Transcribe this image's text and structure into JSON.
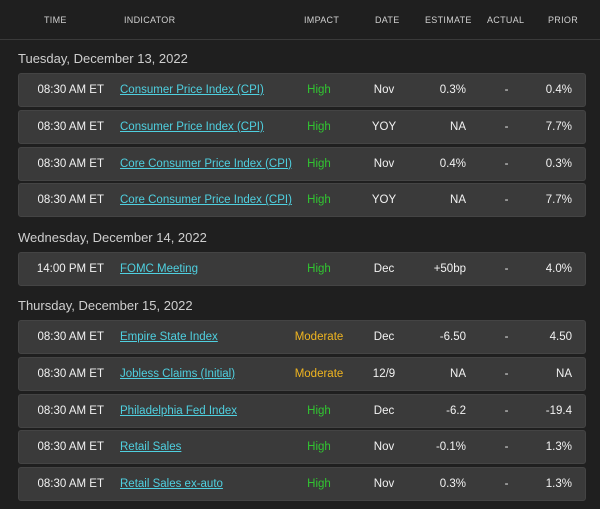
{
  "header": {
    "time": "TIME",
    "indicator": "INDICATOR",
    "impact": "IMPACT",
    "date": "DATE",
    "estimate": "ESTIMATE",
    "actual": "ACTUAL",
    "prior": "PRIOR"
  },
  "colors": {
    "link": "#4fd0e0",
    "high": "#31c531",
    "moderate": "#f0b520",
    "row_bg": "#3a3a3a",
    "page_bg": "#1f1f1f"
  },
  "days": [
    {
      "label": "Tuesday, December 13, 2022",
      "rows": [
        {
          "time": "08:30 AM ET",
          "indicator": "Consumer Price Index (CPI)",
          "impact": "High",
          "date": "Nov",
          "estimate": "0.3%",
          "actual": "-",
          "prior": "0.4%"
        },
        {
          "time": "08:30 AM ET",
          "indicator": "Consumer Price Index (CPI)",
          "impact": "High",
          "date": "YOY",
          "estimate": "NA",
          "actual": "-",
          "prior": "7.7%"
        },
        {
          "time": "08:30 AM ET",
          "indicator": "Core Consumer Price Index (CPI)",
          "impact": "High",
          "date": "Nov",
          "estimate": "0.4%",
          "actual": "-",
          "prior": "0.3%"
        },
        {
          "time": "08:30 AM ET",
          "indicator": "Core Consumer Price Index (CPI)",
          "impact": "High",
          "date": "YOY",
          "estimate": "NA",
          "actual": "-",
          "prior": "7.7%"
        }
      ]
    },
    {
      "label": "Wednesday, December 14, 2022",
      "rows": [
        {
          "time": "14:00 PM ET",
          "indicator": "FOMC Meeting",
          "impact": "High",
          "date": "Dec",
          "estimate": "+50bp",
          "actual": "-",
          "prior": "4.0%"
        }
      ]
    },
    {
      "label": "Thursday, December 15, 2022",
      "rows": [
        {
          "time": "08:30 AM ET",
          "indicator": "Empire State Index",
          "impact": "Moderate",
          "date": "Dec",
          "estimate": "-6.50",
          "actual": "-",
          "prior": "4.50"
        },
        {
          "time": "08:30 AM ET",
          "indicator": "Jobless Claims (Initial)",
          "impact": "Moderate",
          "date": "12/9",
          "estimate": "NA",
          "actual": "-",
          "prior": "NA"
        },
        {
          "time": "08:30 AM ET",
          "indicator": "Philadelphia Fed Index",
          "impact": "High",
          "date": "Dec",
          "estimate": "-6.2",
          "actual": "-",
          "prior": "-19.4"
        },
        {
          "time": "08:30 AM ET",
          "indicator": "Retail Sales",
          "impact": "High",
          "date": "Nov",
          "estimate": "-0.1%",
          "actual": "-",
          "prior": "1.3%"
        },
        {
          "time": "08:30 AM ET",
          "indicator": "Retail Sales ex-auto",
          "impact": "High",
          "date": "Nov",
          "estimate": "0.3%",
          "actual": "-",
          "prior": "1.3%"
        }
      ]
    }
  ]
}
